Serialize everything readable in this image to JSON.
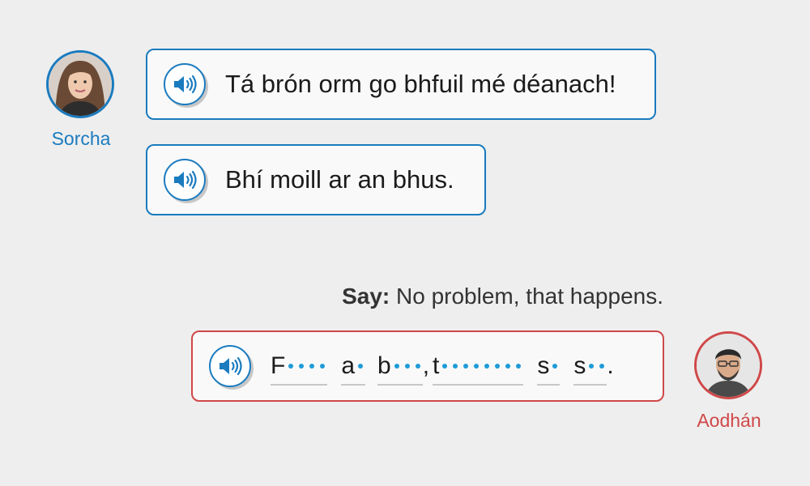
{
  "conversation": {
    "partner": {
      "name": "Sorcha"
    },
    "user": {
      "name": "Aodhán"
    },
    "messages": [
      {
        "text": "Tá brón orm go bhfuil mé déanach!"
      },
      {
        "text": "Bhí moill ar an bhus."
      }
    ],
    "prompt": {
      "label": "Say:",
      "text": "No problem, that happens."
    },
    "answer": {
      "words": [
        {
          "first": "F",
          "hidden_letters": 4
        },
        {
          "first": "a",
          "hidden_letters": 1
        },
        {
          "first": "b",
          "hidden_letters": 3,
          "after": ","
        },
        {
          "first": "t",
          "hidden_letters": 8
        },
        {
          "first": "s",
          "hidden_letters": 1
        },
        {
          "first": "s",
          "hidden_letters": 2,
          "after": "."
        }
      ]
    }
  },
  "icons": {
    "audio": "speaker-volume-icon"
  },
  "colors": {
    "partner_accent": "#1a7bbf",
    "user_accent": "#d04848",
    "blank_dot": "#1e9bd7",
    "background": "#eeeeee"
  }
}
